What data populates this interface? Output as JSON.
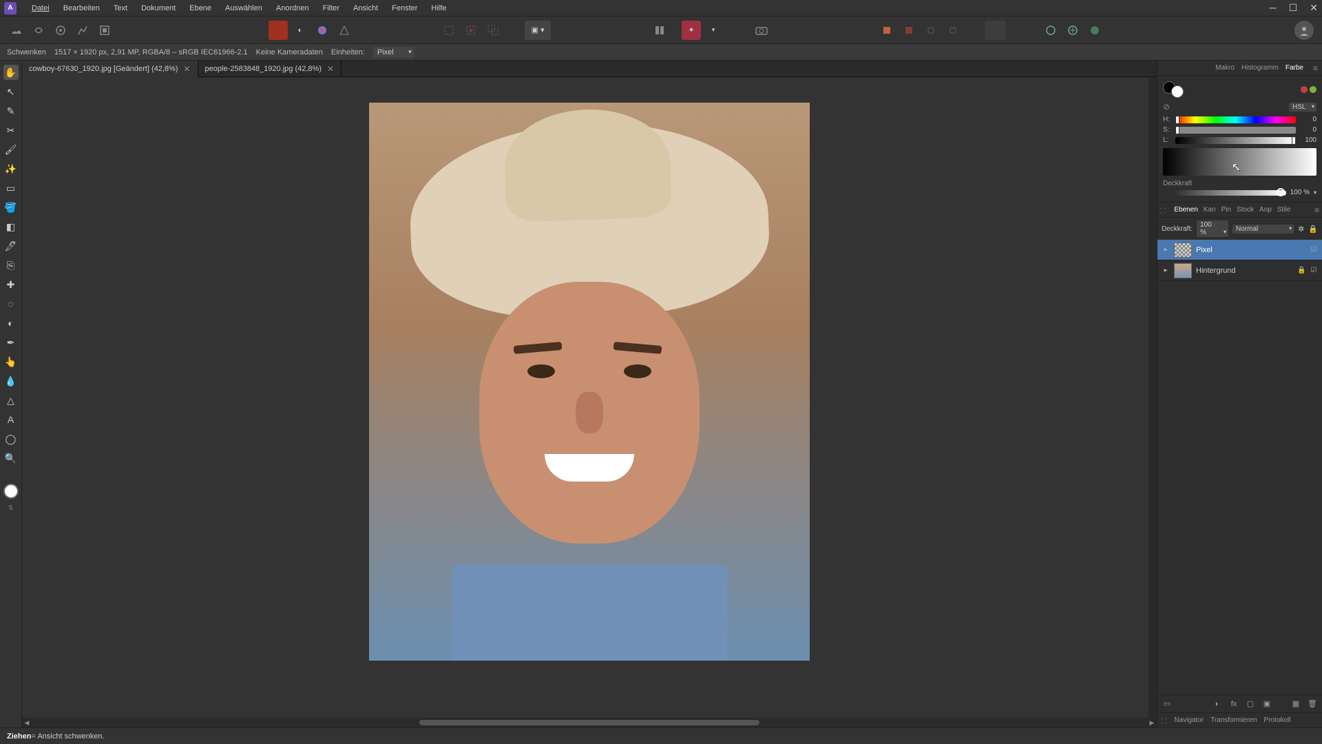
{
  "menubar": [
    "Datei",
    "Bearbeiten",
    "Text",
    "Dokument",
    "Ebene",
    "Auswählen",
    "Anordnen",
    "Filter",
    "Ansicht",
    "Fenster",
    "Hilfe"
  ],
  "context": {
    "tool": "Schwenken",
    "docinfo": "1517 × 1920 px, 2,91 MP, RGBA/8 – sRGB IEC61966-2.1",
    "camera": "Keine Kameradaten",
    "units_label": "Einheiten:",
    "units_value": "Pixel"
  },
  "tabs": [
    {
      "label": "cowboy-67630_1920.jpg [Geändert] (42,8%)",
      "active": true
    },
    {
      "label": "people-2583848_1920.jpg (42,8%)",
      "active": false
    }
  ],
  "right_tabs_top": [
    "Makro",
    "Histogramm",
    "Farbe"
  ],
  "color_panel": {
    "mode": "HSL",
    "h": {
      "label": "H:",
      "value": "0"
    },
    "s": {
      "label": "S:",
      "value": "0"
    },
    "l": {
      "label": "L:",
      "value": "100"
    },
    "opacity_label": "Deckkraft",
    "opacity_value": "100 %"
  },
  "layers_tabs": [
    "Ebenen",
    "Kan",
    "Pin",
    "Stock",
    "Anp",
    "Stile"
  ],
  "layers_header": {
    "opacity_label": "Deckkraft:",
    "opacity_value": "100 %",
    "blend": "Normal"
  },
  "layers": [
    {
      "name": "Pixel",
      "selected": true,
      "thumb": "checker"
    },
    {
      "name": "Hintergrund",
      "selected": false,
      "thumb": "image",
      "locked": true
    }
  ],
  "bottom_tabs": [
    "Navigator",
    "Transformieren",
    "Protokoll"
  ],
  "status": {
    "action": "Ziehen",
    "desc": " = Ansicht schwenken."
  }
}
